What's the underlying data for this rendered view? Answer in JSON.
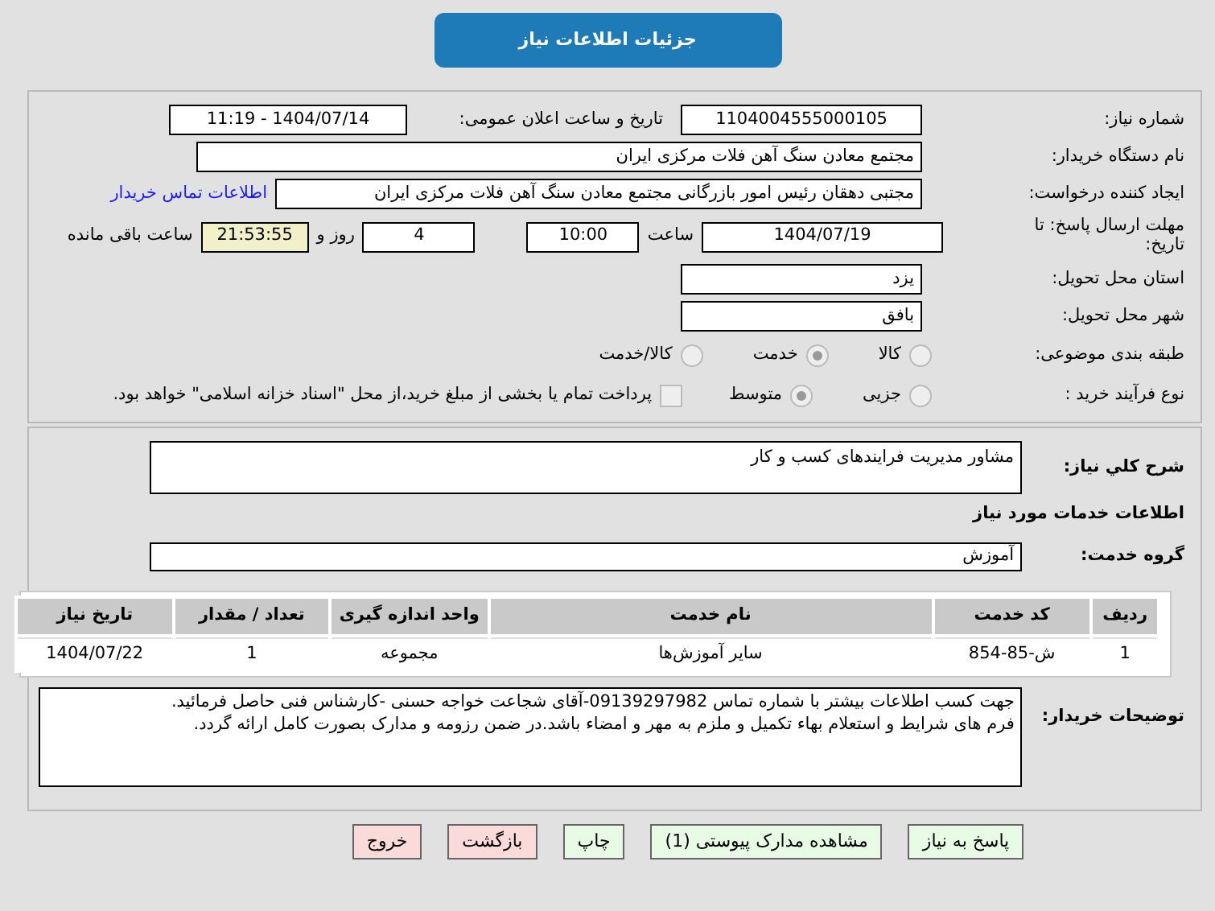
{
  "header": {
    "title": "جزئیات اطلاعات نیاز"
  },
  "need_number": {
    "label": "شماره نیاز:",
    "value": "1104004555000105"
  },
  "announce": {
    "label": "تاریخ و ساعت اعلان عمومی:",
    "value": "1404/07/14 - 11:19"
  },
  "buyer_org": {
    "label": "نام دستگاه خریدار:",
    "value": "مجتمع معادن سنگ آهن فلات مرکزی ایران"
  },
  "creator": {
    "label": "ایجاد کننده درخواست:",
    "value": "مجتبی  دهقان رئیس امور بازرگانی مجتمع معادن سنگ آهن فلات مرکزی ایران",
    "link": "اطلاعات تماس خریدار"
  },
  "deadline": {
    "label": "مهلت ارسال پاسخ: تا تاریخ:",
    "date": "1404/07/19",
    "time_label": "ساعت",
    "time": "10:00",
    "days": "4",
    "days_label": "روز و",
    "remaining": "21:53:55",
    "remaining_label": "ساعت باقی مانده"
  },
  "province": {
    "label": "استان محل تحویل:",
    "value": "یزد"
  },
  "city": {
    "label": "شهر محل تحویل:",
    "value": "بافق"
  },
  "category": {
    "label": "طبقه بندی موضوعی:",
    "options": [
      {
        "label": "کالا",
        "selected": false
      },
      {
        "label": "خدمت",
        "selected": true
      },
      {
        "label": "کالا/خدمت",
        "selected": false
      }
    ]
  },
  "process": {
    "label": "نوع فرآیند خرید :",
    "options": [
      {
        "label": "جزیی",
        "selected": false
      },
      {
        "label": "متوسط",
        "selected": true
      }
    ],
    "payment": {
      "label": "پرداخت تمام یا بخشی از مبلغ خرید،از محل \"اسناد خزانه اسلامی\" خواهد بود.",
      "checked": false
    }
  },
  "summary": {
    "label": "شرح کلي نياز:",
    "value": "مشاور مدیریت فرایندهای کسب و کار"
  },
  "services_title": "اطلاعات خدمات مورد نیاز",
  "service_group": {
    "label": "گروه خدمت:",
    "value": "آموزش"
  },
  "table": {
    "columns": [
      "ردیف",
      "کد خدمت",
      "نام خدمت",
      "واحد اندازه گیری",
      "تعداد / مقدار",
      "تاریخ نیاز"
    ],
    "rows": [
      [
        "1",
        "ش-85-854",
        "سایر آموزش‌ها",
        "مجموعه",
        "1",
        "1404/07/22"
      ]
    ]
  },
  "buyer_notes": {
    "label": "توضیحات خریدار:",
    "value": "جهت کسب اطلاعات بیشتر با شماره تماس 09139297982-آقای شجاعت خواجه حسنی -کارشناس فنی حاصل فرمائید.\nفرم های شرایط و استعلام بهاء تکمیل و ملزم به مهر و امضاء باشد.در ضمن رزومه و مدارک بصورت کامل ارائه گردد."
  },
  "buttons": [
    {
      "label": "پاسخ به نیاز",
      "kind": "normal"
    },
    {
      "label": "مشاهده مدارک پیوستی (1)",
      "kind": "normal"
    },
    {
      "label": "چاپ",
      "kind": "normal"
    },
    {
      "label": "بازگشت",
      "kind": "danger"
    },
    {
      "label": "خروج",
      "kind": "danger"
    }
  ]
}
